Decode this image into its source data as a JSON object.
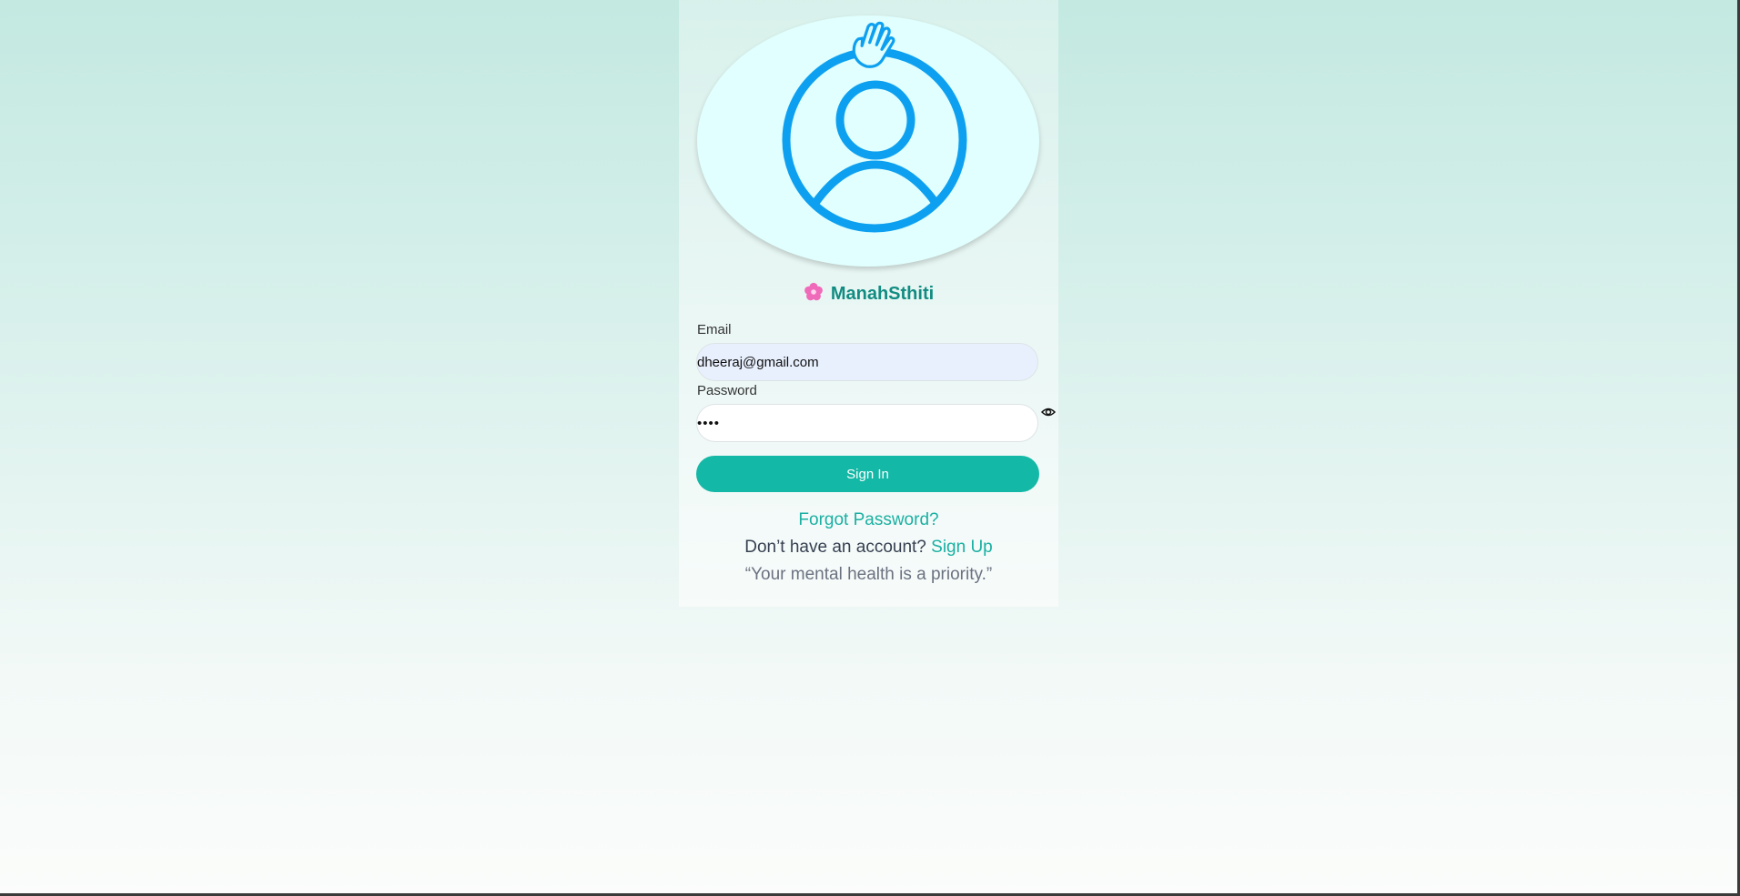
{
  "brand": {
    "name": "ManahSthiti",
    "icon": "flower-icon",
    "accent_color": "#128c82"
  },
  "avatar": {
    "icon": "waving-user-avatar-icon",
    "color": "#0ea0f0"
  },
  "form": {
    "email_label": "Email",
    "email_value": "dheeraj@gmail.com",
    "password_label": "Password",
    "password_value": "••••",
    "show_password_icon": "eye-icon",
    "submit_label": "Sign In"
  },
  "links": {
    "forgot_password": "Forgot Password?",
    "no_account_text": "Don’t have an account?",
    "sign_up": "Sign Up"
  },
  "quote": "“Your mental health is a priority.”",
  "colors": {
    "primary": "#13b8a6",
    "link": "#1ab0a2"
  }
}
